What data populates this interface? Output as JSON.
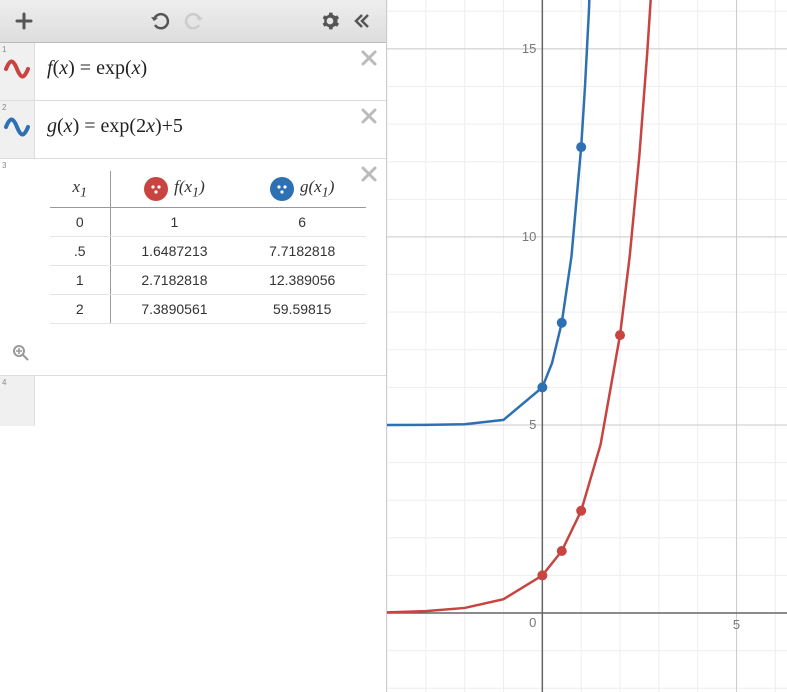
{
  "toolbar": {
    "add": "+",
    "undo": "↶",
    "redo": "↷",
    "settings": "⚙",
    "collapse": "«"
  },
  "expressions": [
    {
      "idx": "1",
      "latex_html": "<span>f</span><span class='rm'>(</span><span>x</span><span class='rm'>)</span> <span class='rm'>=</span> <span class='rm'>exp(</span><span>x</span><span class='rm'>)</span>",
      "color": "#c74440"
    },
    {
      "idx": "2",
      "latex_html": "<span>g</span><span class='rm'>(</span><span>x</span><span class='rm'>)</span> <span class='rm'>=</span> <span class='rm'>exp(</span><span class='rm'>2</span><span>x</span><span class='rm'>)</span><span class='rm'>+5</span>",
      "color": "#2d70b3"
    }
  ],
  "table": {
    "idx": "3",
    "headers": {
      "x": "x<sub>1</sub>",
      "f": "f(x<sub>1</sub>)",
      "g": "g(x<sub>1</sub>)"
    },
    "rows": [
      {
        "x": "0",
        "f": "1",
        "g": "6"
      },
      {
        "x": ".5",
        "f": "1.6487213",
        "g": "7.7182818"
      },
      {
        "x": "1",
        "f": "2.7182818",
        "g": "12.389056"
      },
      {
        "x": "2",
        "f": "7.3890561",
        "g": "59.59815"
      }
    ]
  },
  "row4_idx": "4",
  "graph": {
    "axis_ticks": {
      "y": [
        "15",
        "10",
        "5",
        "0"
      ],
      "x": [
        "5"
      ]
    }
  },
  "chart_data": {
    "type": "line",
    "title": "",
    "xlabel": "",
    "ylabel": "",
    "xlim": [
      -4,
      6.3
    ],
    "ylim": [
      -2.1,
      16.3
    ],
    "series": [
      {
        "name": "f(x) = exp(x)",
        "color": "#c74440",
        "kind": "curve",
        "samples_x": [
          -4,
          -3,
          -2,
          -1,
          0,
          0.5,
          1,
          1.5,
          2,
          2.25,
          2.5,
          2.7,
          2.79
        ],
        "samples_y": [
          0.018,
          0.05,
          0.135,
          0.368,
          1,
          1.649,
          2.718,
          4.482,
          7.389,
          9.488,
          12.182,
          14.88,
          16.3
        ]
      },
      {
        "name": "g(x) = exp(2x)+5",
        "color": "#2d70b3",
        "kind": "curve",
        "samples_x": [
          -4,
          -3,
          -2,
          -1,
          0,
          0.25,
          0.5,
          0.75,
          1,
          1.1,
          1.2,
          1.21
        ],
        "samples_y": [
          5.0,
          5.002,
          5.018,
          5.135,
          6,
          6.649,
          7.718,
          9.482,
          12.389,
          14.025,
          16.023,
          16.3
        ]
      },
      {
        "name": "f(x1) points",
        "color": "#c74440",
        "kind": "scatter",
        "x": [
          0,
          0.5,
          1,
          2
        ],
        "y": [
          1,
          1.6487213,
          2.7182818,
          7.3890561
        ]
      },
      {
        "name": "g(x1) points",
        "color": "#2d70b3",
        "kind": "scatter",
        "x": [
          0,
          0.5,
          1,
          2
        ],
        "y": [
          6,
          7.7182818,
          12.389056,
          59.59815
        ]
      }
    ]
  }
}
